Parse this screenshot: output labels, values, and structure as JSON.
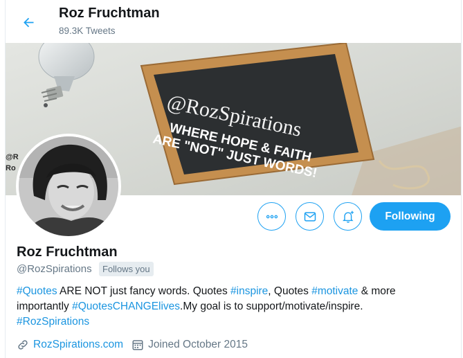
{
  "colors": {
    "accent": "#1da1f2",
    "link": "#1b95e0",
    "secondary_text": "#657786",
    "primary_text": "#14171a"
  },
  "header": {
    "name": "Roz Fruchtman",
    "tweet_count": "89.3K Tweets",
    "back_icon": "arrow-left-icon"
  },
  "banner": {
    "chalkboard_title": "@RozSpirations",
    "chalkboard_line1": "WHERE HOPE & FAITH",
    "chalkboard_line2": "ARE \"NOT\" JUST WORDS!",
    "corner_text_1": "@R",
    "corner_text_2": "Ro"
  },
  "actions": {
    "more_icon": "more-horizontal-icon",
    "message_icon": "envelope-icon",
    "notify_icon": "bell-plus-icon",
    "following_label": "Following"
  },
  "profile": {
    "name": "Roz Fruchtman",
    "handle": "@RozSpirations",
    "follows_you": "Follows you",
    "bio": {
      "t1": "#Quotes",
      "t2": " ARE NOT just fancy words. Quotes ",
      "t3": "#inspire",
      "t4": ", Quotes ",
      "t5": "#motivate",
      "t6": " & more importantly ",
      "t7": "#QuotesCHANGElives",
      "t8": ".My goal is to support/motivate/inspire. ",
      "t9": "#RozSpirations"
    },
    "website": "RozSpirations.com",
    "joined": "Joined October 2015",
    "link_icon": "link-icon",
    "calendar_icon": "calendar-icon"
  }
}
